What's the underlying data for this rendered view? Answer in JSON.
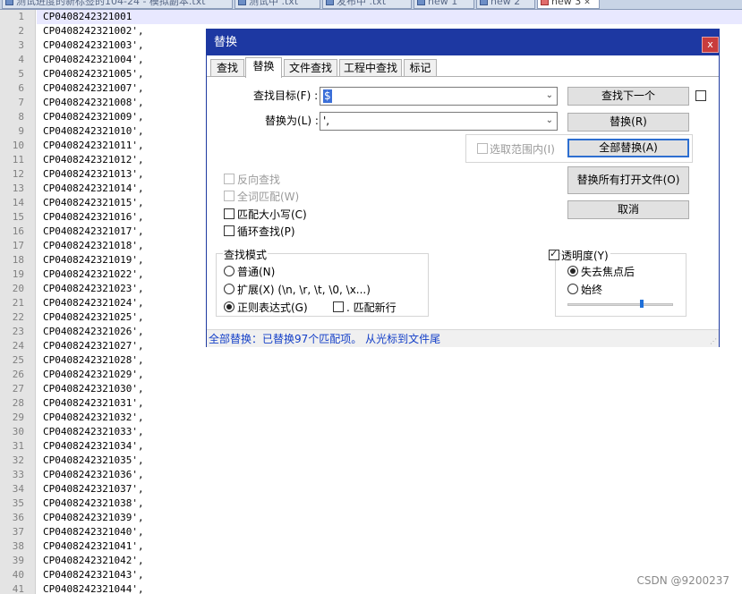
{
  "file_tabs": [
    {
      "label": "测试进度的新标签的104-24 - 模拟副本.txt",
      "active": false
    },
    {
      "label": "测试中 .txt",
      "active": false
    },
    {
      "label": "发布中 .txt",
      "active": false
    },
    {
      "label": "new 1",
      "active": false
    },
    {
      "label": "new 2",
      "active": false
    },
    {
      "label": "new 3",
      "active": true
    }
  ],
  "editor": {
    "line_numbers": [
      "1",
      "2",
      "3",
      "4",
      "5",
      "6",
      "7",
      "8",
      "9",
      "10",
      "11",
      "12",
      "13",
      "14",
      "15",
      "16",
      "17",
      "18",
      "19",
      "20",
      "21",
      "22",
      "23",
      "24",
      "25",
      "26",
      "27",
      "28",
      "29",
      "30",
      "31",
      "32",
      "33",
      "34",
      "35",
      "36",
      "37",
      "38",
      "39",
      "40",
      "41"
    ],
    "lines": [
      "CP0408242321001",
      "CP0408242321002',",
      "CP0408242321003',",
      "CP0408242321004',",
      "CP0408242321005',",
      "CP0408242321007',",
      "CP0408242321008',",
      "CP0408242321009',",
      "CP0408242321010',",
      "CP0408242321011',",
      "CP0408242321012',",
      "CP0408242321013',",
      "CP0408242321014',",
      "CP0408242321015',",
      "CP0408242321016',",
      "CP0408242321017',",
      "CP0408242321018',",
      "CP0408242321019',",
      "CP0408242321022',",
      "CP0408242321023',",
      "CP0408242321024',",
      "CP0408242321025',",
      "CP0408242321026',",
      "CP0408242321027',",
      "CP0408242321028',",
      "CP0408242321029',",
      "CP0408242321030',",
      "CP0408242321031',",
      "CP0408242321032',",
      "CP0408242321033',",
      "CP0408242321034',",
      "CP0408242321035',",
      "CP0408242321036',",
      "CP0408242321037',",
      "CP0408242321038',",
      "CP0408242321039',",
      "CP0408242321040',",
      "CP0408242321041',",
      "CP0408242321042',",
      "CP0408242321043',",
      "CP0408242321044',"
    ]
  },
  "dialog": {
    "title": "替换",
    "close": "x",
    "tabs": [
      "查找",
      "替换",
      "文件查找",
      "工程中查找",
      "标记"
    ],
    "find_label": "查找目标(F) :",
    "find_value": "$",
    "replace_label": "替换为(L) :",
    "replace_value": "',",
    "in_selection": "选取范围内(I)",
    "buttons": {
      "find_next": "查找下一个",
      "replace": "替换(R)",
      "replace_all": "全部替换(A)",
      "replace_all_open": "替换所有打开文件(O)",
      "cancel": "取消"
    },
    "options": {
      "backward": "反向查找",
      "whole_word": "全词匹配(W)",
      "match_case": "匹配大小写(C)",
      "wrap": "循环查找(P)"
    },
    "search_mode": {
      "title": "查找模式",
      "normal": "普通(N)",
      "extended": "扩展(X) (\\n, \\r, \\t, \\0, \\x...)",
      "regex": "正则表达式(G)",
      "dot_newline": ". 匹配新行"
    },
    "transparency": {
      "title": "透明度(Y)",
      "on_lose_focus": "失去焦点后",
      "always": "始终",
      "level": 0.7
    },
    "status": "全部替换：已替换97个匹配项。 从光标到文件尾"
  },
  "watermark": "CSDN @9200237"
}
